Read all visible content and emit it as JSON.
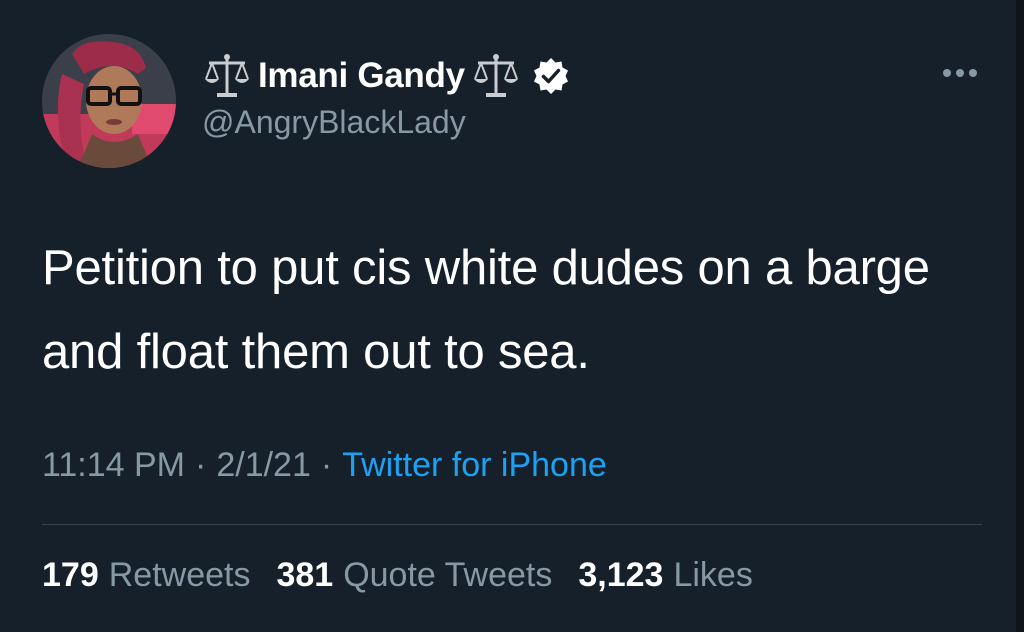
{
  "tweet": {
    "author": {
      "display_name": "Imani Gandy",
      "handle": "@AngryBlackLady",
      "verified": true,
      "name_emoji": "scales-icon"
    },
    "text": "Petition to put cis white dudes on a barge and float them out to sea.",
    "meta": {
      "time": "11:14 PM",
      "separator": "·",
      "date": "2/1/21",
      "source": "Twitter for iPhone"
    },
    "stats": [
      {
        "count": "179",
        "label": "Retweets"
      },
      {
        "count": "381",
        "label": "Quote Tweets"
      },
      {
        "count": "3,123",
        "label": "Likes"
      }
    ]
  },
  "colors": {
    "background": "#15202b",
    "text_primary": "#ffffff",
    "text_secondary": "#8899a6",
    "link": "#1da1f2",
    "divider": "#38444d"
  }
}
